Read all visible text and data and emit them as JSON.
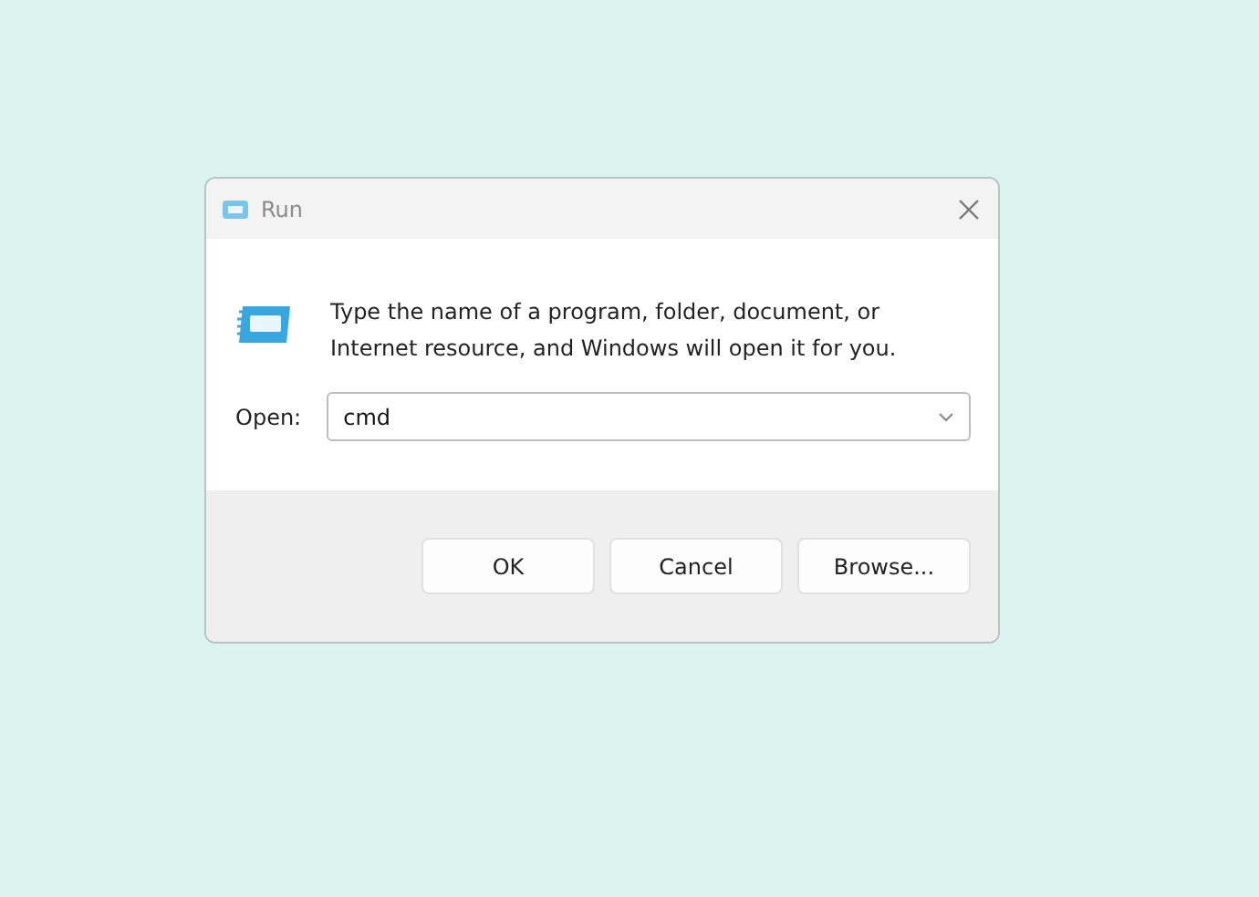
{
  "window": {
    "title": "Run"
  },
  "message": "Type the name of a program, folder, document, or Internet resource, and Windows will open it for you.",
  "open_field": {
    "label": "Open:",
    "value": "cmd"
  },
  "buttons": [
    {
      "label": "OK"
    },
    {
      "label": "Cancel"
    },
    {
      "label": "Browse..."
    }
  ]
}
